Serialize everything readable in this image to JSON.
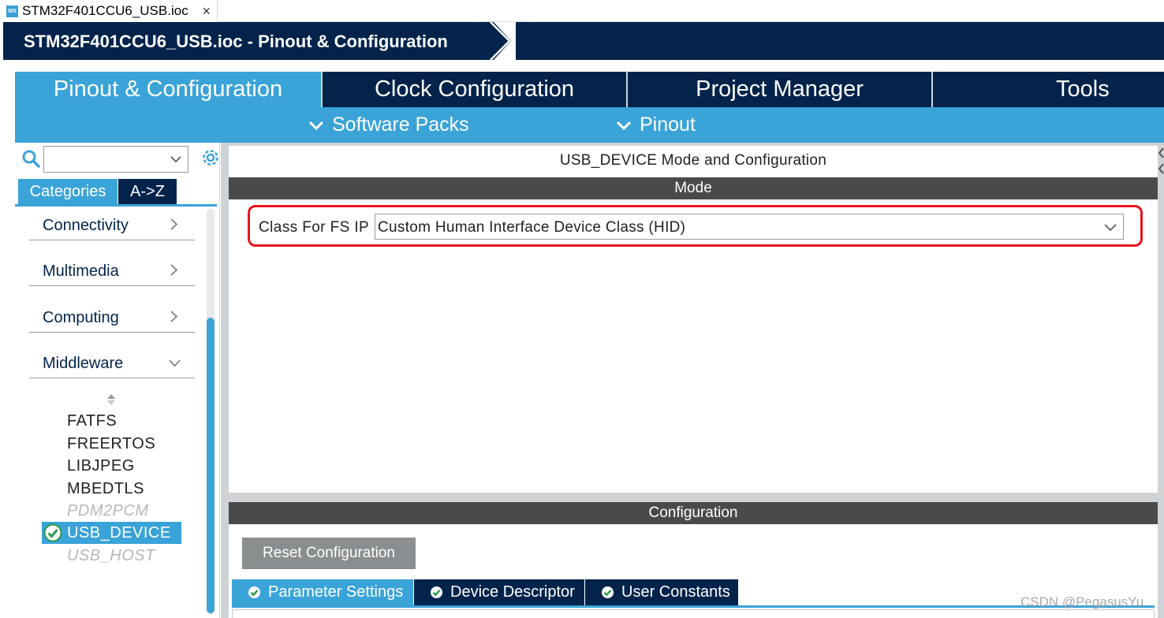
{
  "editor_tab": {
    "icon_label": "MX",
    "label": "STM32F401CCU6_USB.ioc",
    "close": "×"
  },
  "window": {
    "title": "STM32F401CCU6_USB.ioc - Pinout & Configuration"
  },
  "main_tabs": [
    {
      "label": "Pinout & Configuration",
      "active": true
    },
    {
      "label": "Clock Configuration"
    },
    {
      "label": "Project Manager"
    },
    {
      "label": "Tools"
    }
  ],
  "sub_tabs": [
    {
      "label": "Software Packs",
      "icon": "chevron-down-icon"
    },
    {
      "label": "Pinout",
      "icon": "chevron-down-icon"
    }
  ],
  "left_panel": {
    "search": {
      "value": ""
    },
    "view_tabs": [
      {
        "label": "Categories",
        "active": true
      },
      {
        "label": "A->Z"
      }
    ],
    "categories": [
      {
        "label": "Connectivity",
        "icon": "chevron-right-icon"
      },
      {
        "label": "Multimedia",
        "icon": "chevron-right-icon"
      },
      {
        "label": "Computing",
        "icon": "chevron-right-icon"
      },
      {
        "label": "Middleware",
        "icon": "chevron-down-icon",
        "expanded": true
      }
    ],
    "middleware_items": [
      {
        "label": "FATFS"
      },
      {
        "label": "FREERTOS"
      },
      {
        "label": "LIBJPEG"
      },
      {
        "label": "MBEDTLS"
      },
      {
        "label": "PDM2PCM",
        "disabled": true
      },
      {
        "label": "USB_DEVICE",
        "selected": true,
        "icon": "check-circle-icon"
      },
      {
        "label": "USB_HOST",
        "disabled": true
      }
    ]
  },
  "mode_panel": {
    "title": "USB_DEVICE Mode and Configuration",
    "section": "Mode",
    "class_label": "Class For FS IP",
    "class_value": "Custom Human Interface Device Class (HID)"
  },
  "config_panel": {
    "section": "Configuration",
    "reset_label": "Reset Configuration",
    "tabs": [
      {
        "label": "Parameter Settings",
        "active": true,
        "icon": "check-circle-icon"
      },
      {
        "label": "Device Descriptor",
        "icon": "check-circle-icon"
      },
      {
        "label": "User Constants",
        "icon": "check-circle-icon"
      }
    ]
  },
  "watermark": "CSDN @PegasusYu",
  "colors": {
    "navy": "#03234b",
    "accent": "#3aa3d8",
    "highlight_outline": "#e5131d",
    "section_header": "#4a4a4a"
  }
}
